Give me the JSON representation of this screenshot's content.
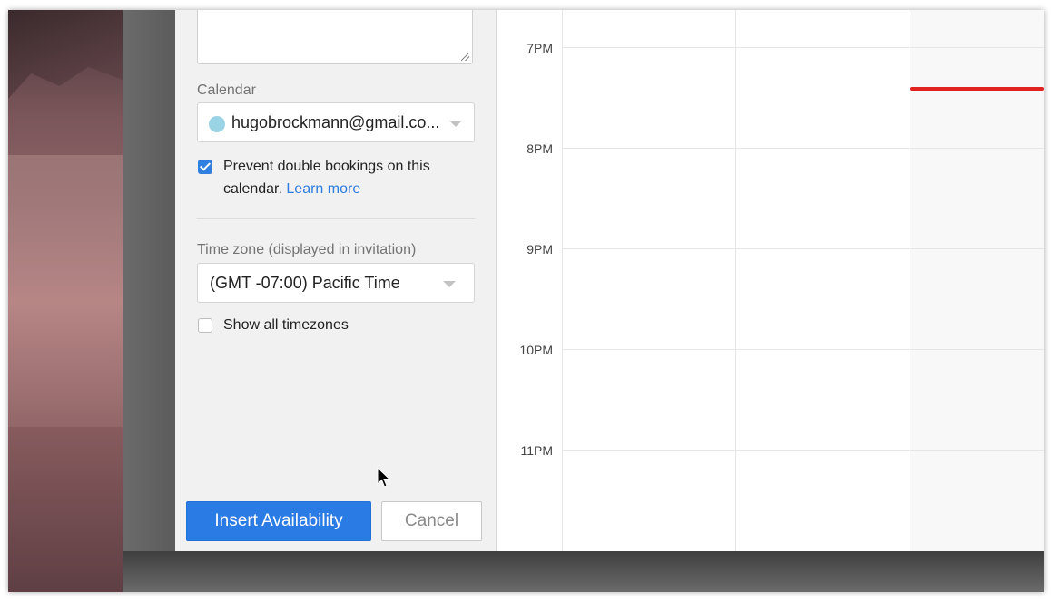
{
  "panel": {
    "calendar_label": "Calendar",
    "calendar_value": "hugobrockmann@gmail.co...",
    "calendar_color": "#9ad4e4",
    "prevent_double_booking": {
      "checked": true,
      "text": "Prevent double bookings on this calendar.",
      "link": "Learn more"
    },
    "timezone_label": "Time zone (displayed in invitation)",
    "timezone_value": "(GMT -07:00) Pacific Time",
    "show_all_timezones": {
      "checked": false,
      "text": "Show all timezones"
    },
    "insert_button": "Insert Availability",
    "cancel_button": "Cancel"
  },
  "calendar": {
    "hours": [
      "7PM",
      "8PM",
      "9PM",
      "10PM",
      "11PM"
    ],
    "current_time_color": "#e0231e"
  },
  "colors": {
    "accent": "#2b7be4",
    "panel_bg": "#f1f1f1"
  }
}
